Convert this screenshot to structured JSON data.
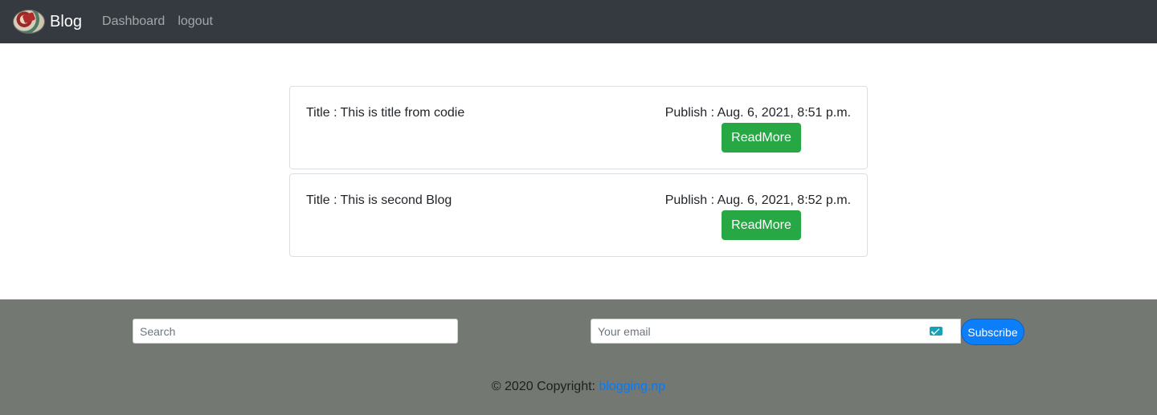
{
  "navbar": {
    "brand": "Blog",
    "links": {
      "dashboard": "Dashboard",
      "logout": "logout"
    }
  },
  "posts": [
    {
      "title_label": "Title :",
      "title": "This is title from codie",
      "publish_label": "Publish :",
      "publish_date": "Aug. 6, 2021, 8:51 p.m.",
      "button": "ReadMore"
    },
    {
      "title_label": "Title :",
      "title": "This is second Blog",
      "publish_label": "Publish :",
      "publish_date": "Aug. 6, 2021, 8:52 p.m.",
      "button": "ReadMore"
    }
  ],
  "footer": {
    "search_placeholder": "Search",
    "email_placeholder": "Your email",
    "subscribe_label": "Subscribe",
    "copyright_text": "© 2020 Copyright:",
    "copyright_link": "blogging.np"
  },
  "icons": {
    "brand_logo": "blog-logo-icon",
    "email": "mail-icon"
  },
  "colors": {
    "navbar": "#343a40",
    "footer": "#737873",
    "readmore": "#28a745",
    "subscribe": "#0d7ef9",
    "link": "#007bff"
  }
}
